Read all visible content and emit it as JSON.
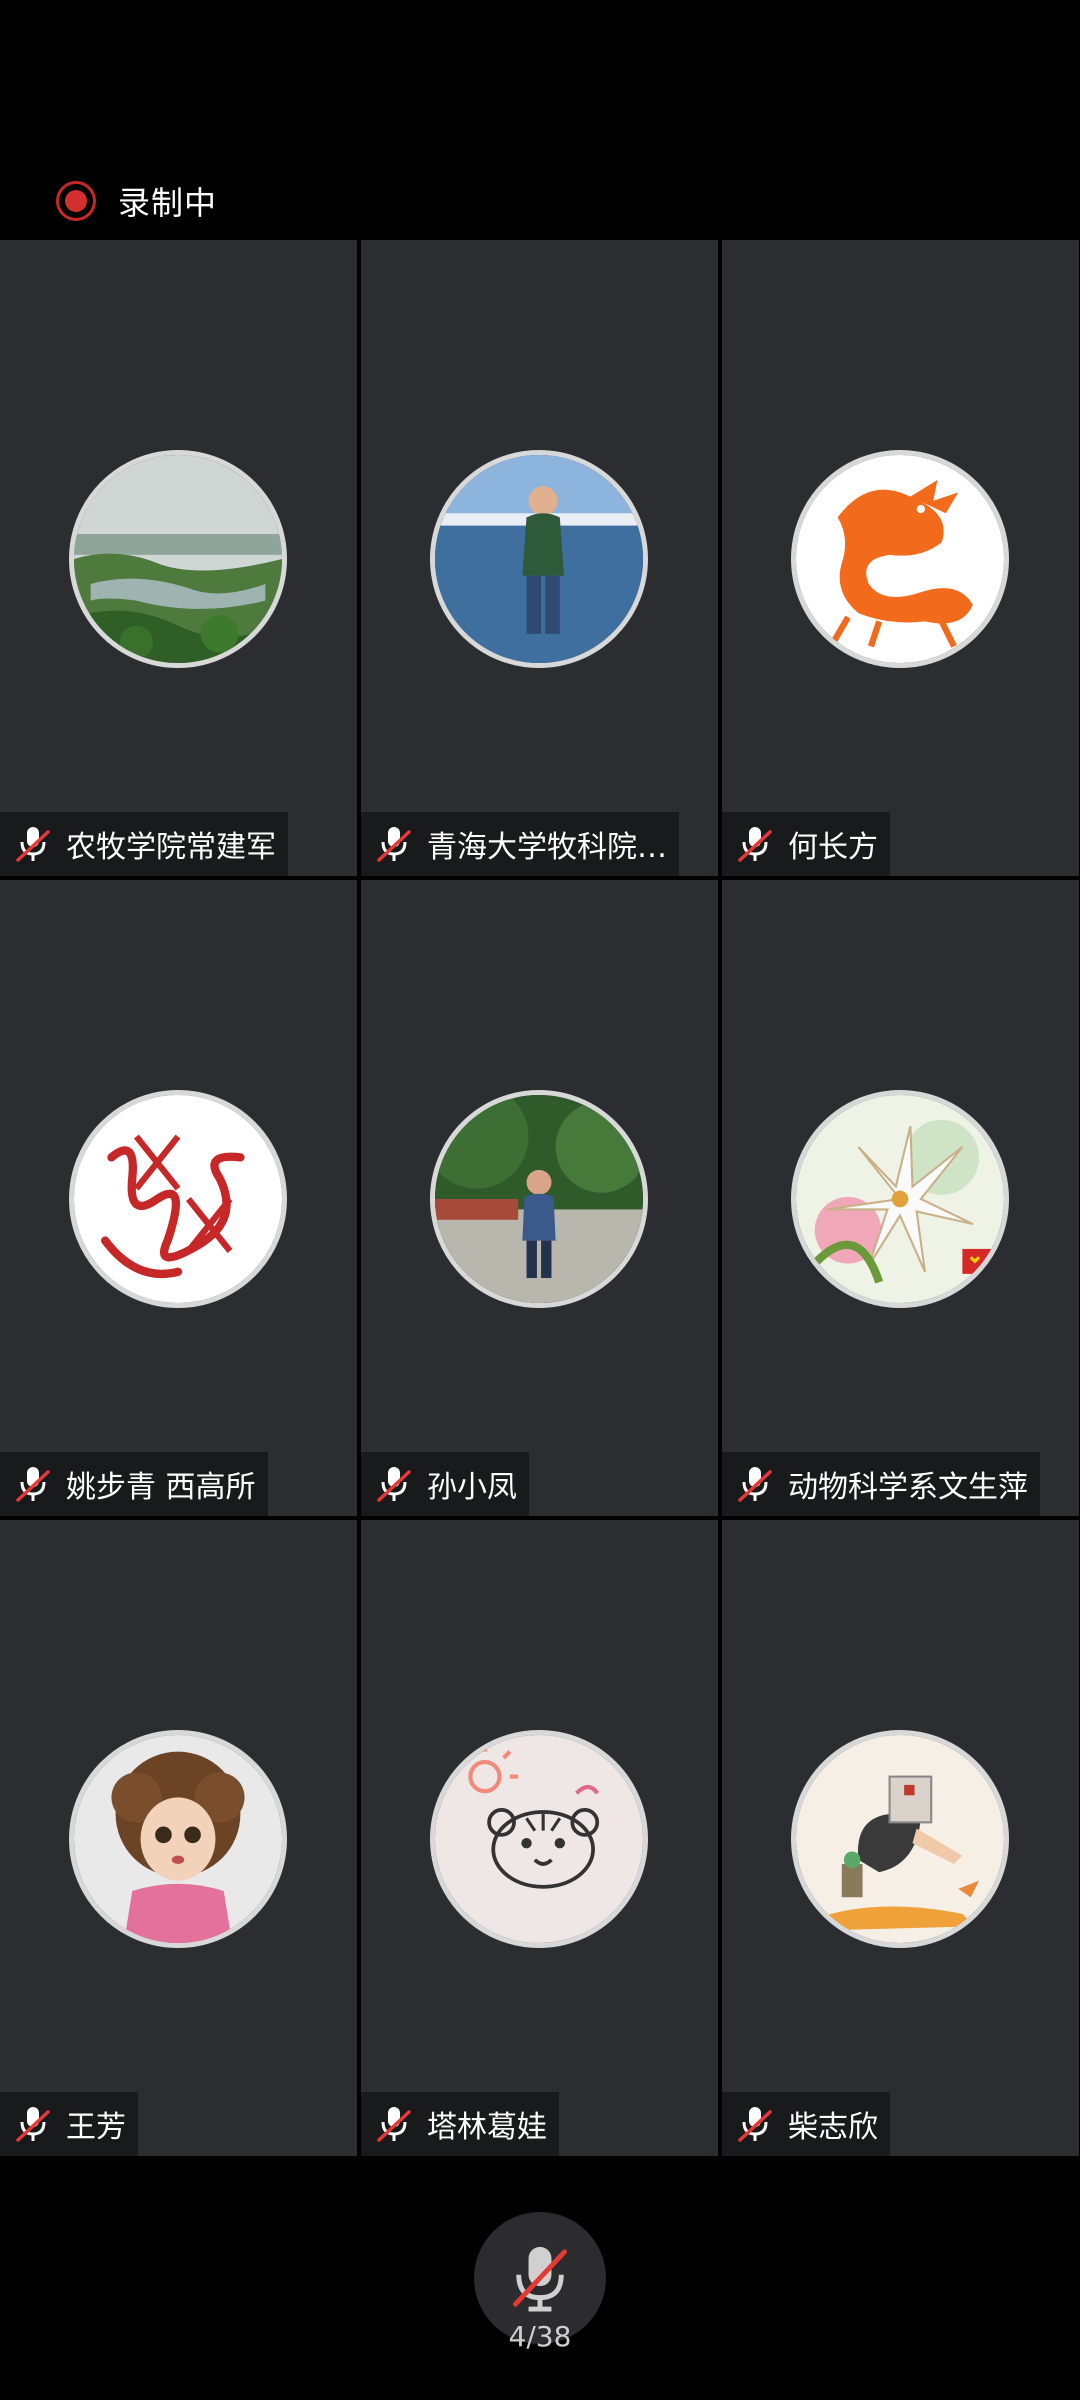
{
  "recording": {
    "label": "录制中",
    "dot_color": "#d32f2f",
    "icon": "record-icon"
  },
  "participants": [
    {
      "name": "农牧学院常建军",
      "muted": true,
      "avatar": "landscape-photo"
    },
    {
      "name": "青海大学牧科院…",
      "muted": true,
      "avatar": "person-photo"
    },
    {
      "name": "何长方",
      "muted": true,
      "avatar": "dragon-papercut"
    },
    {
      "name": "姚步青 西高所",
      "muted": true,
      "avatar": "calligraphy-signature"
    },
    {
      "name": "孙小凤",
      "muted": true,
      "avatar": "person-photo"
    },
    {
      "name": "动物科学系文生萍",
      "muted": true,
      "avatar": "lily-painting"
    },
    {
      "name": "王芳",
      "muted": true,
      "avatar": "doll-photo"
    },
    {
      "name": "塔林葛娃",
      "muted": true,
      "avatar": "tiger-drawing"
    },
    {
      "name": "柴志欣",
      "muted": true,
      "avatar": "illustration"
    }
  ],
  "bottom": {
    "mic_icon": "mic-muted-icon",
    "page_indicator": "4/38"
  },
  "colors": {
    "background": "#000000",
    "tile": "#2b2d30",
    "mute_slash": "#e53935"
  }
}
